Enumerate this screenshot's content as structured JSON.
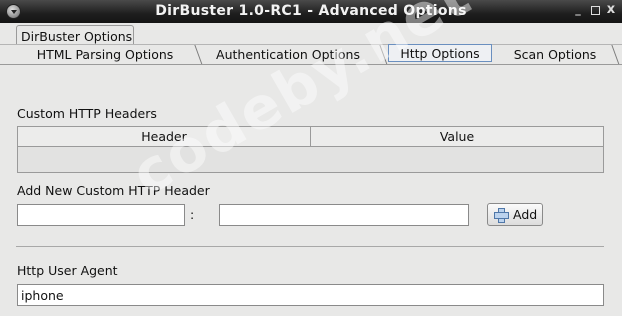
{
  "window": {
    "title": "DirBuster 1.0-RC1 - Advanced Options",
    "minimize_glyph": "_",
    "close_glyph": "x"
  },
  "outer_tab": {
    "label": "DirBuster Options"
  },
  "tabs": [
    {
      "label": "HTML Parsing Options",
      "active": false
    },
    {
      "label": "Authentication Options",
      "active": false
    },
    {
      "label": "Http Options",
      "active": true
    },
    {
      "label": "Scan Options",
      "active": false
    }
  ],
  "custom_headers": {
    "section_label": "Custom HTTP Headers",
    "columns": [
      "Header",
      "Value"
    ],
    "rows": []
  },
  "add_header": {
    "section_label": "Add New Custom HTTP Header",
    "header_value": "",
    "separator": ":",
    "value_value": "",
    "button_label": "Add",
    "button_icon": "plus-icon"
  },
  "user_agent": {
    "label": "Http User Agent",
    "value": "iphone"
  },
  "watermark": "codeby.net",
  "colors": {
    "titlebar": "#1e1e1e",
    "background": "#e8e8e7",
    "active_tab_border": "#6a8fbf"
  }
}
